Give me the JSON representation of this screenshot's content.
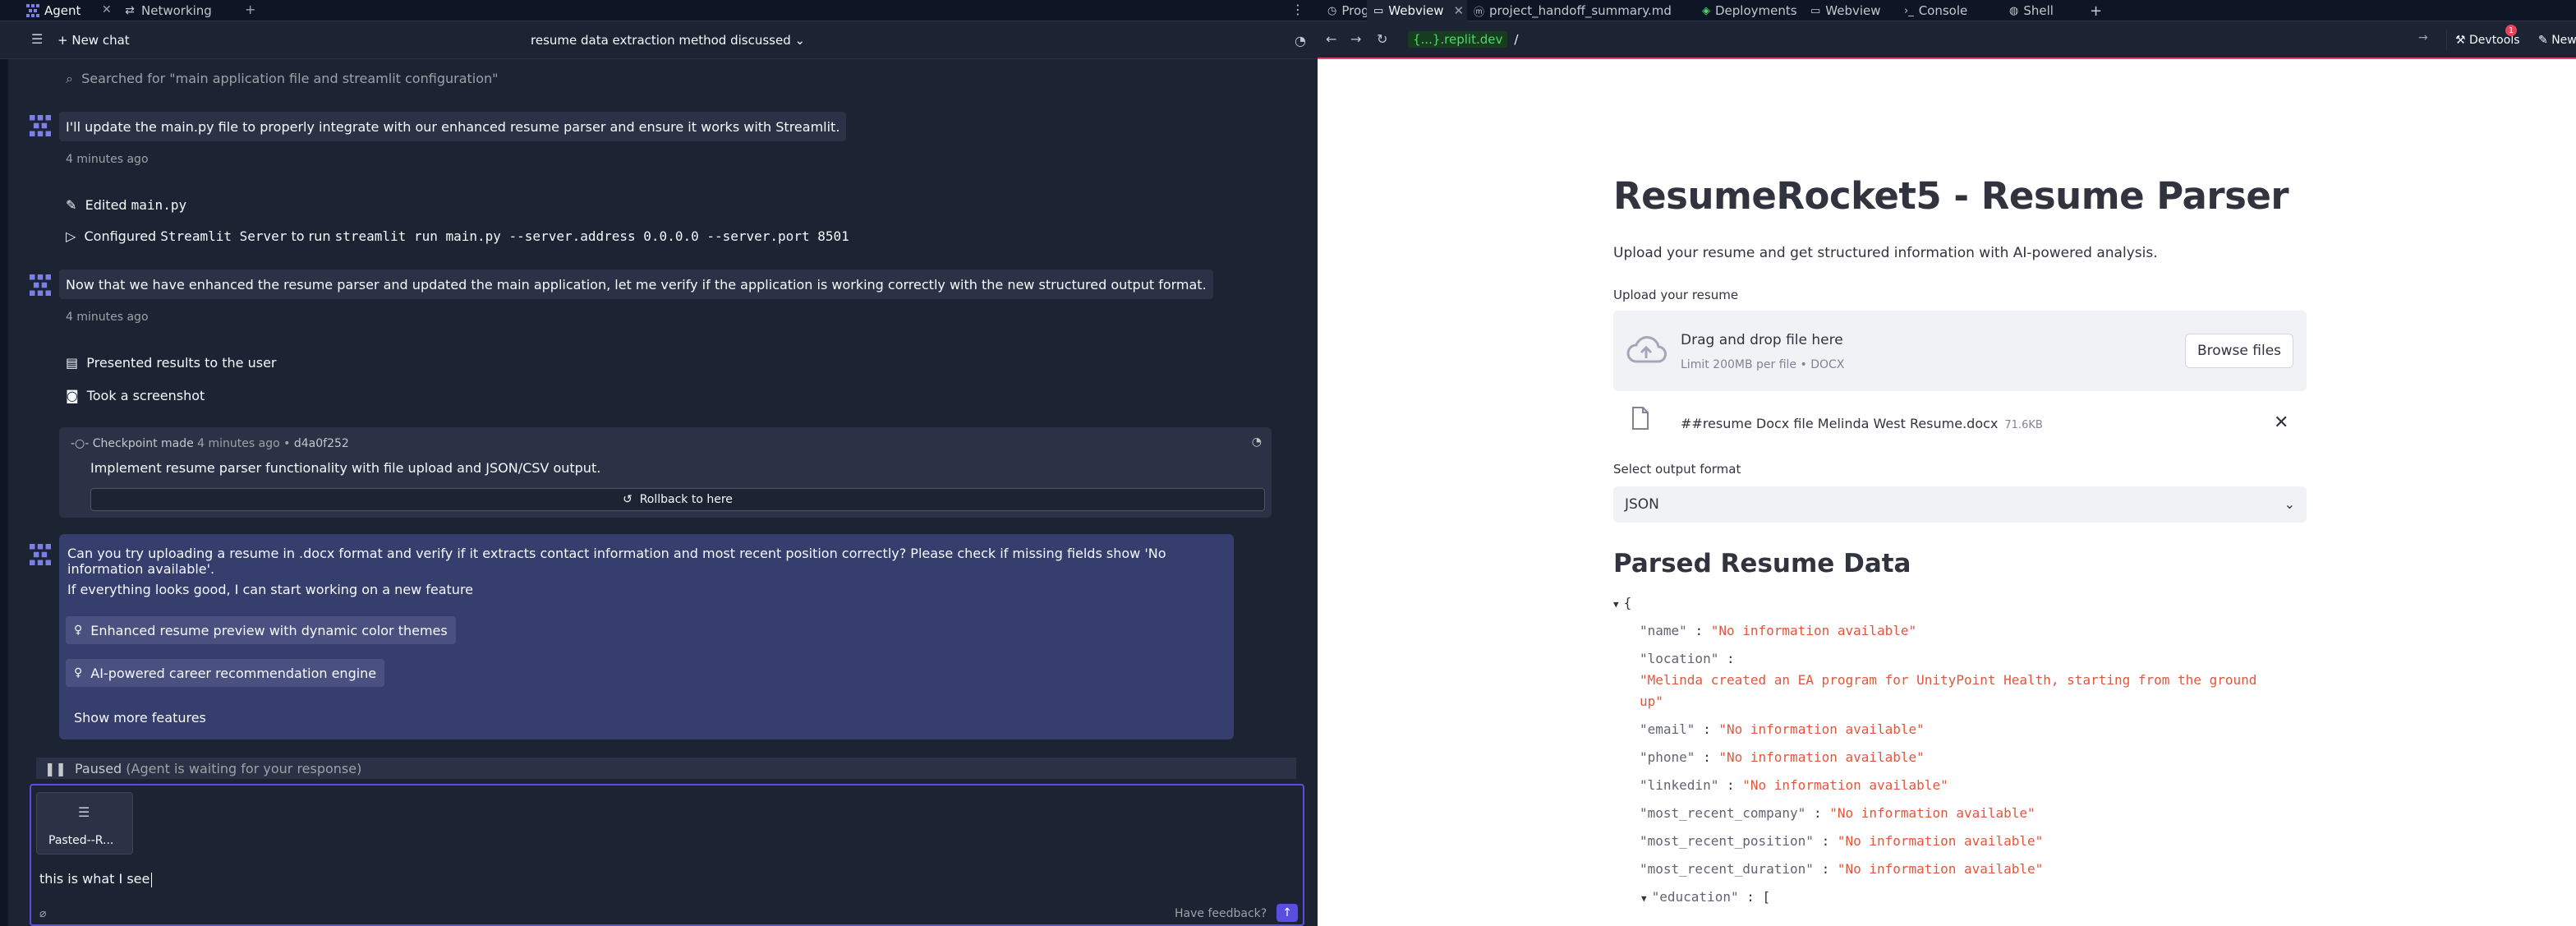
{
  "left_tabs": [
    {
      "label": "Agent"
    },
    {
      "label": "Networking"
    }
  ],
  "chat_header": {
    "new_chat": "New chat",
    "title": "resume data extraction method discussed"
  },
  "search_note": "Searched for \"main application file and streamlit configuration\"",
  "messages": {
    "m1": "I'll update the main.py file to properly integrate with our enhanced resume parser and ensure it works with Streamlit.",
    "m1_time": "4 minutes ago",
    "edited_prefix": "Edited",
    "edited_file": "main.py",
    "configured_prefix": "Configured",
    "configured_name": "Streamlit Server",
    "configured_mid": "to run",
    "configured_cmd": "streamlit run main.py --server.address 0.0.0.0 --server.port 8501",
    "m2": "Now that we have enhanced the resume parser and updated the main application, let me verify if the application is working correctly with the new structured output format.",
    "m2_time": "4 minutes ago",
    "action1": "Presented results to the user",
    "action2": "Took a screenshot"
  },
  "checkpoint": {
    "label": "Checkpoint made",
    "time": "4 minutes ago",
    "sep": "•",
    "hash": "d4a0f252",
    "description": "Implement resume parser functionality with file upload and JSON/CSV output.",
    "rollback": "Rollback to here"
  },
  "question": {
    "text": "Can you try uploading a resume in .docx format and verify if it extracts contact information and most recent position correctly? Please check if missing fields show 'No information available'.",
    "followup": "If everything looks good, I can start working on a new feature",
    "suggestions": [
      "Enhanced resume preview with dynamic color themes",
      "AI-powered career recommendation engine"
    ],
    "more": "Show more features"
  },
  "paused": {
    "label": "Paused",
    "detail": "(Agent is waiting for your response)"
  },
  "input": {
    "attachment_name": "Pasted--R...",
    "value": "this is what I see",
    "feedback": "Have feedback?"
  },
  "right_tabs": [
    {
      "label": "Progress"
    },
    {
      "label": "Webview"
    },
    {
      "label": "project_handoff_summary.md"
    },
    {
      "label": "Deployments"
    },
    {
      "label": "Webview"
    },
    {
      "label": "Console"
    },
    {
      "label": "Shell"
    }
  ],
  "browser": {
    "host": "{...}.replit.dev",
    "path": "/",
    "devtools": "Devtools",
    "devtools_badge": "1",
    "new_tab": "New"
  },
  "app": {
    "title": "ResumeRocket5 - Resume Parser",
    "subtitle": "Upload your resume and get structured information with AI-powered analysis.",
    "upload_label": "Upload your resume",
    "drop_title": "Drag and drop file here",
    "drop_limit": "Limit 200MB per file • DOCX",
    "browse": "Browse files",
    "file_name": "##resume Docx file Melinda West Resume.docx",
    "file_size": "71.6KB",
    "format_label": "Select output format",
    "format_value": "JSON",
    "parsed_heading": "Parsed Resume Data"
  },
  "parsed_json": {
    "open_brace": "{",
    "name_key": "\"name\"",
    "name_val": "\"No information available\"",
    "location_key": "\"location\"",
    "location_val_1": "\"Melinda created an EA program for UnityPoint Health, starting from the ground",
    "location_val_2": "up\"",
    "email_key": "\"email\"",
    "email_val": "\"No information available\"",
    "phone_key": "\"phone\"",
    "phone_val": "\"No information available\"",
    "linkedin_key": "\"linkedin\"",
    "linkedin_val": "\"No information available\"",
    "company_key": "\"most_recent_company\"",
    "company_val": "\"No information available\"",
    "position_key": "\"most_recent_position\"",
    "position_val": "\"No information available\"",
    "duration_key": "\"most_recent_duration\"",
    "duration_val": "\"No information available\"",
    "education_key": "\"education\"",
    "education_open": "[",
    "colon": ":"
  },
  "colors": {
    "accent": "#5a4ee0",
    "json_string": "#e2563c",
    "host_green": "#4fd86b"
  }
}
